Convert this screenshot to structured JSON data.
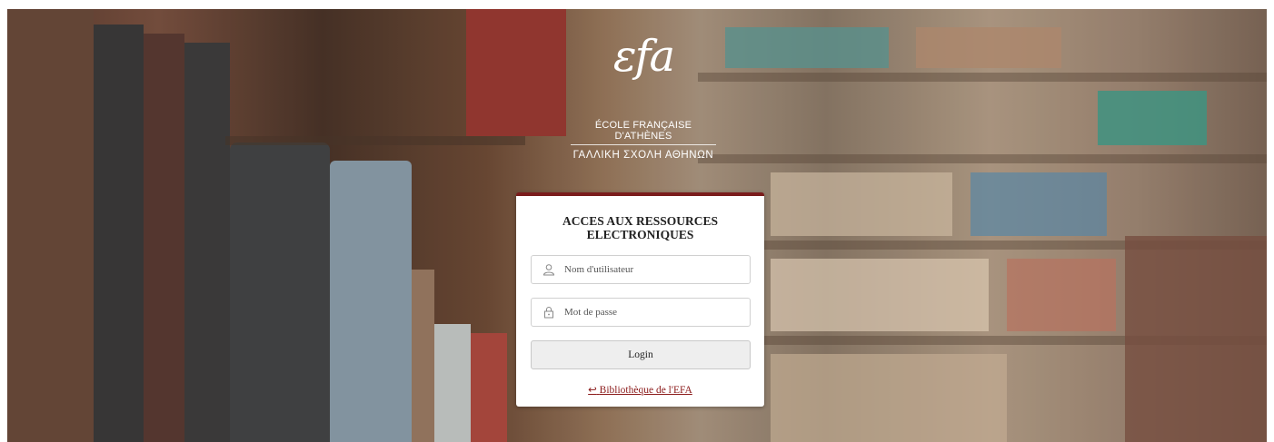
{
  "logo": {
    "mark": "εfa",
    "line1": "ÉCOLE FRANÇAISE D'ATHÈNES",
    "line2": "ΓΑΛΛΙΚΗ ΣΧΟΛΗ ΑΘΗΝΩΝ"
  },
  "login": {
    "title_line1": "ACCES AUX RESSOURCES",
    "title_line2": "ELECTRONIQUES",
    "username_placeholder": "Nom d'utilisateur",
    "username_value": "",
    "password_placeholder": "Mot de passe",
    "password_value": "",
    "login_label": "Login",
    "library_link_arrow": "↩",
    "library_link_label": "Bibliothèque de l'EFA"
  },
  "icons": {
    "username": "user-icon",
    "password": "lock-icon"
  },
  "colors": {
    "accent": "#7a1c1c",
    "link": "#8b1a1a",
    "button_bg": "#eeeeee"
  }
}
